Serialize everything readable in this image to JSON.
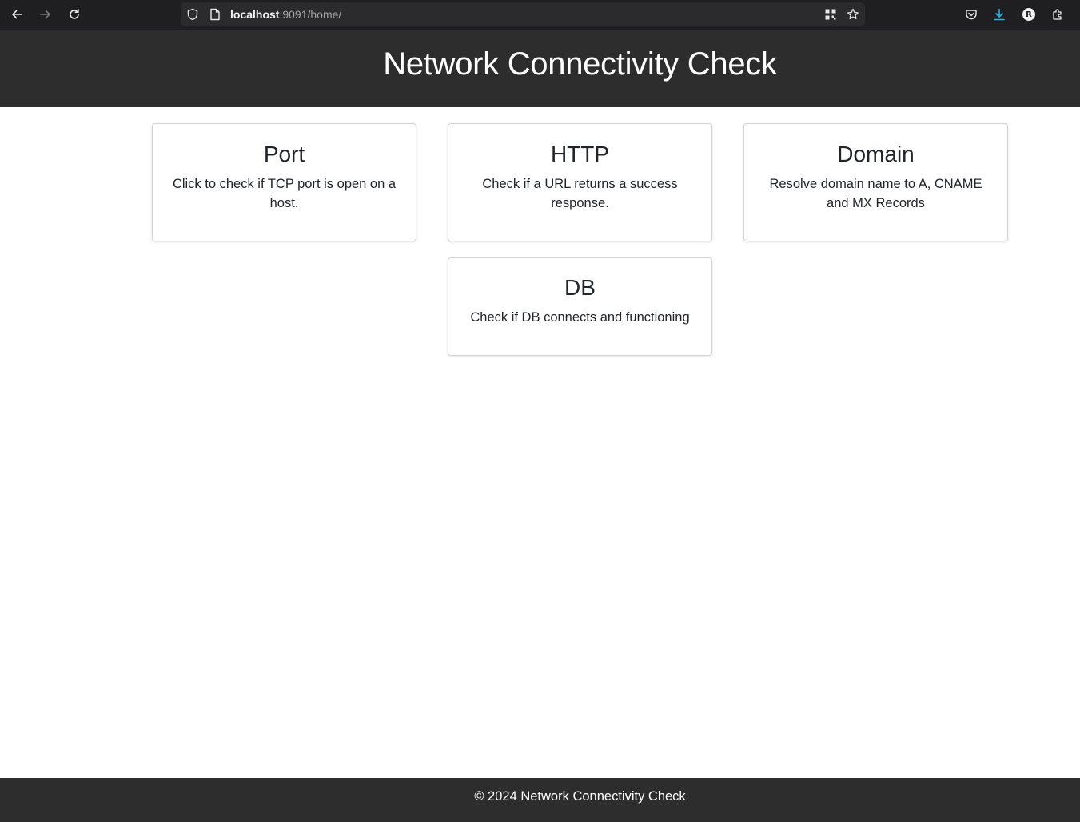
{
  "browser": {
    "url_host": "localhost",
    "url_path": ":9091/home/",
    "icons": [
      "back-icon",
      "forward-icon",
      "reload-icon",
      "shield-icon",
      "page-icon",
      "qr-code-icon",
      "bookmark-star-icon",
      "pocket-icon",
      "download-icon",
      "profile-avatar",
      "extensions-icon"
    ],
    "avatar_letter": "R"
  },
  "header": {
    "title": "Network Connectivity Check"
  },
  "cards": [
    {
      "title": "Port",
      "description": "Click to check if TCP port is open on a host."
    },
    {
      "title": "HTTP",
      "description": "Check if a URL returns a success response."
    },
    {
      "title": "Domain",
      "description": "Resolve domain name to A, CNAME and MX Records"
    },
    {
      "title": "DB",
      "description": "Check if DB connects and functioning"
    }
  ],
  "footer": {
    "text": "© 2024 Network Connectivity Check"
  },
  "colors": {
    "header_bg": "#2d2d2d",
    "footer_bg": "#2d2d2d",
    "card_border": "#d2d4d6",
    "download_accent": "#2bb0e6"
  }
}
